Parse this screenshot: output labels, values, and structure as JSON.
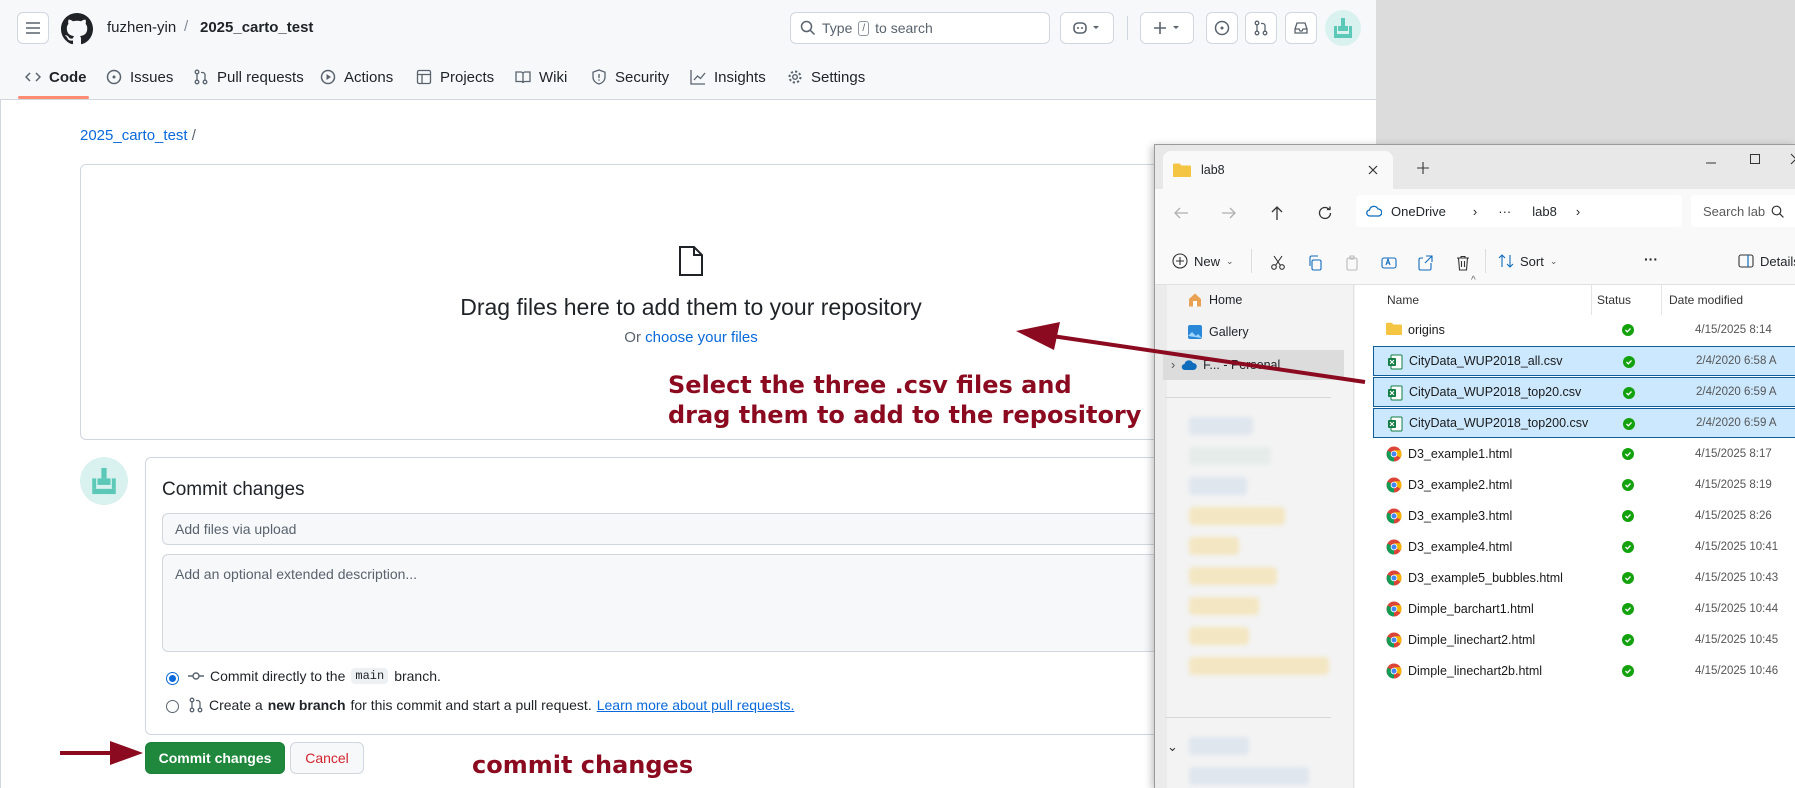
{
  "github": {
    "owner": "fuzhen-yin",
    "separator": "/",
    "repo": "2025_carto_test",
    "search_placeholder_pre": "Type",
    "search_key": "/",
    "search_placeholder_post": "to search",
    "tabs": [
      "Code",
      "Issues",
      "Pull requests",
      "Actions",
      "Projects",
      "Wiki",
      "Security",
      "Insights",
      "Settings"
    ],
    "breadcrumb_repo": "2025_carto_test",
    "breadcrumb_sep": "/",
    "drop_title": "Drag files here to add them to your repository",
    "drop_or": "Or",
    "drop_link": "choose your files",
    "commit_title": "Commit changes",
    "summary_placeholder": "Add files via upload",
    "desc_placeholder": "Add an optional extended description...",
    "radio1_pre": "Commit directly to the",
    "radio1_branch": "main",
    "radio1_post": "branch.",
    "radio2_pre": "Create a",
    "radio2_bold": "new branch",
    "radio2_post": "for this commit and start a pull request.",
    "radio2_link": "Learn more about pull requests.",
    "commit_button": "Commit changes",
    "cancel_button": "Cancel",
    "accent_green": "#1f883d",
    "link_color": "#0969da"
  },
  "explorer": {
    "tab_title": "lab8",
    "address": [
      "OneDrive",
      "›",
      "···",
      "lab8",
      "›"
    ],
    "search_placeholder": "Search lab",
    "toolbar": {
      "new": "New",
      "sort": "Sort",
      "more": "···",
      "details": "Details"
    },
    "columns": {
      "name": "Name",
      "status": "Status",
      "date": "Date modified"
    },
    "nav": {
      "home": "Home",
      "gallery": "Gallery",
      "personal": "F... - Personal"
    },
    "files": [
      {
        "name": "origins",
        "date": "4/15/2025 8:14",
        "type": "folder",
        "selected": false
      },
      {
        "name": "CityData_WUP2018_all.csv",
        "date": "2/4/2020 6:58 A",
        "type": "excel",
        "selected": true
      },
      {
        "name": "CityData_WUP2018_top20.csv",
        "date": "2/4/2020 6:59 A",
        "type": "excel",
        "selected": true
      },
      {
        "name": "CityData_WUP2018_top200.csv",
        "date": "2/4/2020 6:59 A",
        "type": "excel",
        "selected": true
      },
      {
        "name": "D3_example1.html",
        "date": "4/15/2025 8:17",
        "type": "chrome",
        "selected": false
      },
      {
        "name": "D3_example2.html",
        "date": "4/15/2025 8:19",
        "type": "chrome",
        "selected": false
      },
      {
        "name": "D3_example3.html",
        "date": "4/15/2025 8:26",
        "type": "chrome",
        "selected": false
      },
      {
        "name": "D3_example4.html",
        "date": "4/15/2025 10:41",
        "type": "chrome",
        "selected": false
      },
      {
        "name": "D3_example5_bubbles.html",
        "date": "4/15/2025 10:43",
        "type": "chrome",
        "selected": false
      },
      {
        "name": "Dimple_barchart1.html",
        "date": "4/15/2025 10:44",
        "type": "chrome",
        "selected": false
      },
      {
        "name": "Dimple_linechart2.html",
        "date": "4/15/2025 10:45",
        "type": "chrome",
        "selected": false
      },
      {
        "name": "Dimple_linechart2b.html",
        "date": "4/15/2025 10:46",
        "type": "chrome",
        "selected": false
      }
    ]
  },
  "annotations": {
    "select_line1": "Select the three .csv files and",
    "select_line2": "drag them to add to the repository",
    "commit": "commit changes",
    "color": "#8b0a1f"
  }
}
